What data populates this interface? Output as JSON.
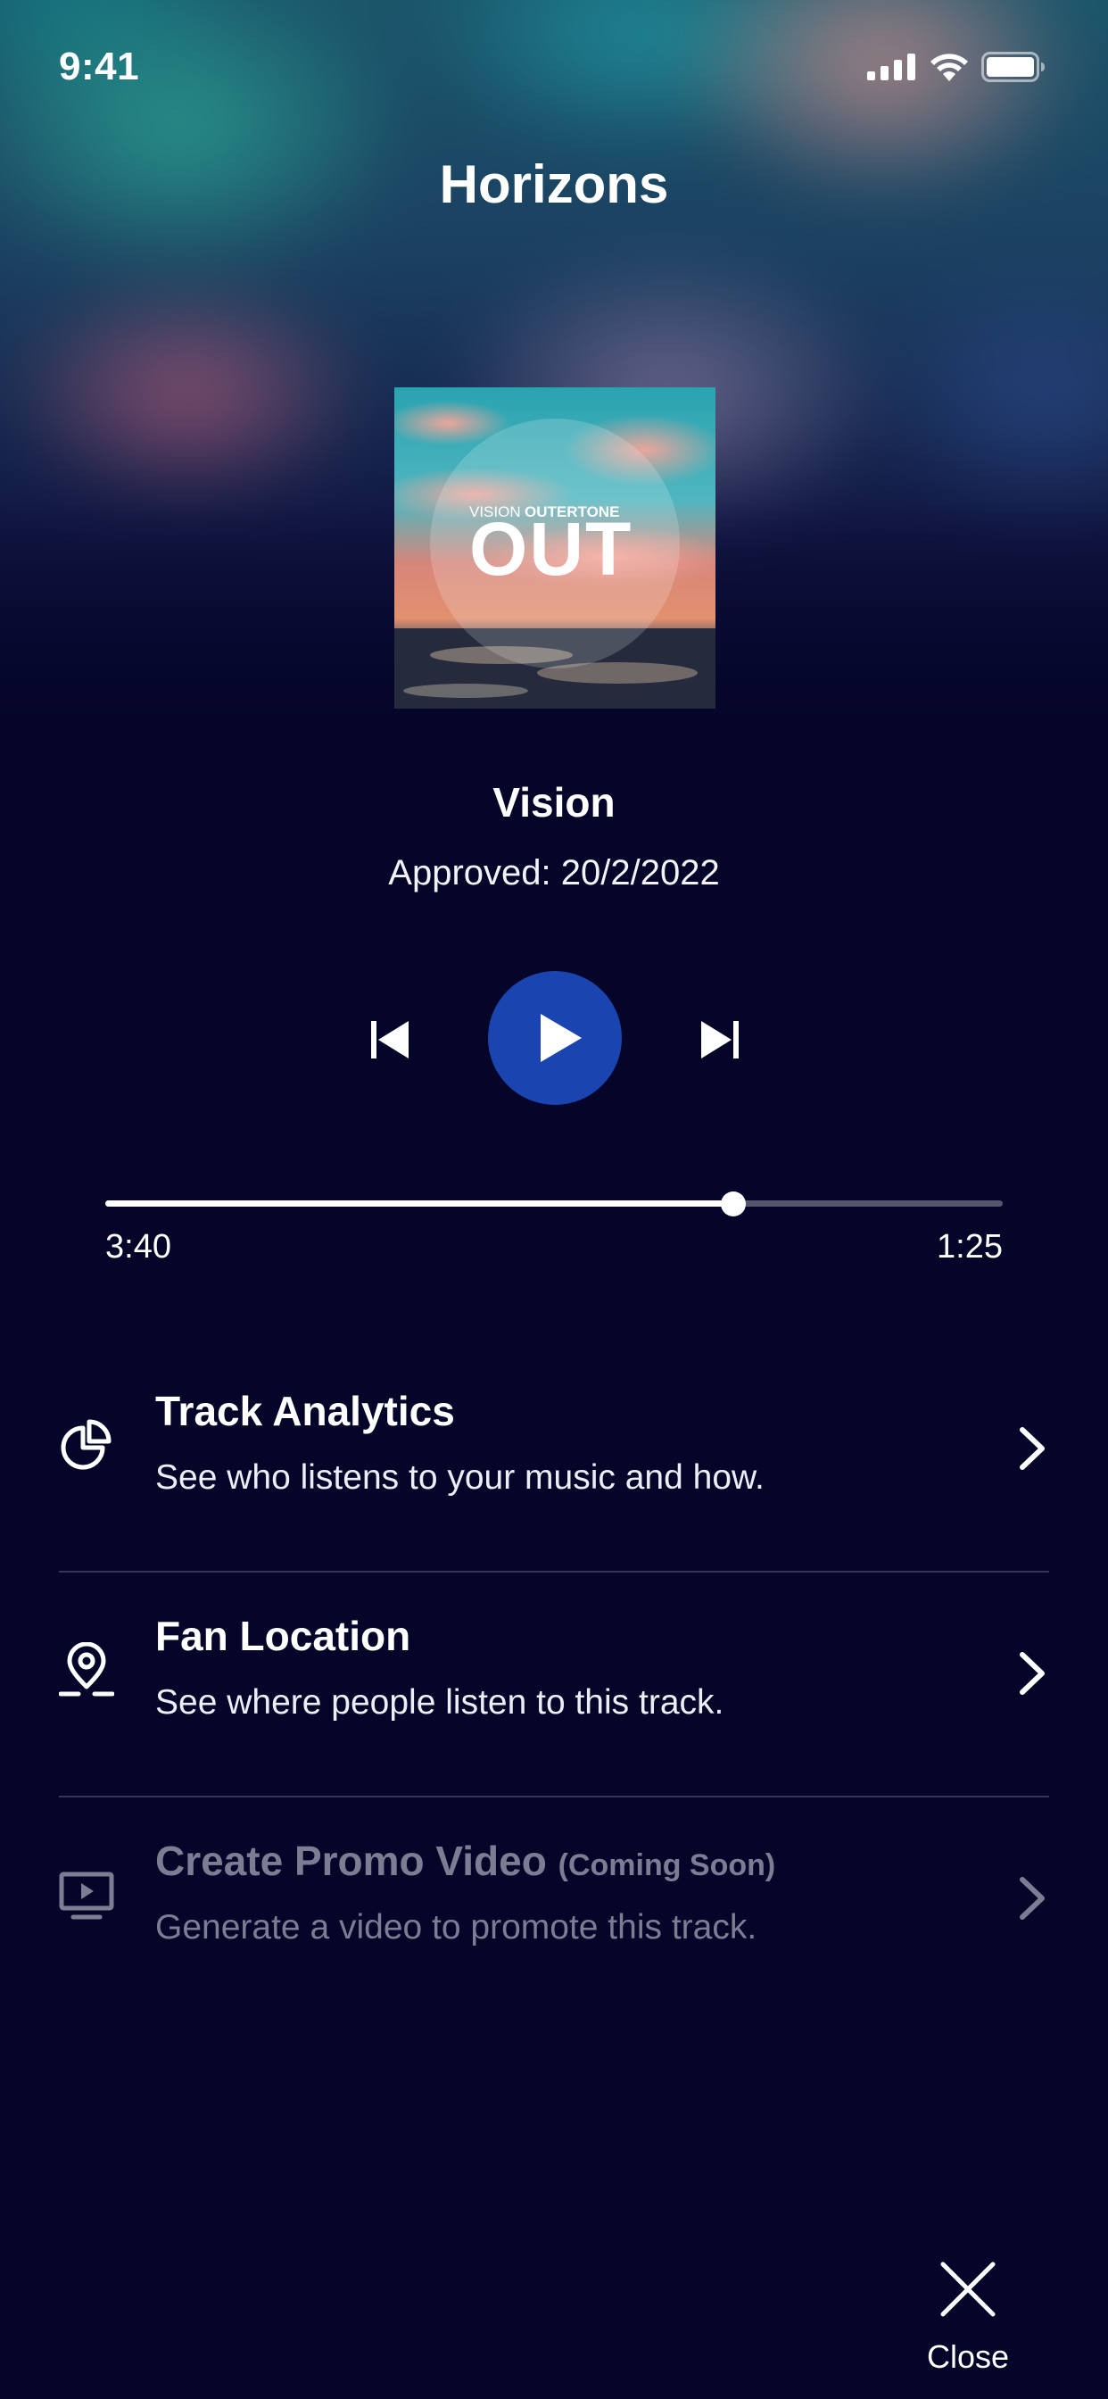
{
  "status_bar": {
    "time": "9:41",
    "icons": [
      "cellular-signal-icon",
      "wifi-icon",
      "battery-icon"
    ]
  },
  "screen": {
    "title": "Horizons"
  },
  "album_art": {
    "label_small": "VISION",
    "label_brand": "OUTERTONE",
    "label_large": "OUT"
  },
  "track": {
    "title": "Vision",
    "approved": "Approved: 20/2/2022"
  },
  "controls": {
    "prev_icon": "skip-previous-icon",
    "play_icon": "play-icon",
    "next_icon": "skip-next-icon",
    "play_color": "#1a45b0"
  },
  "progress": {
    "elapsed": "3:40",
    "remaining": "1:25",
    "fraction": 0.7
  },
  "menu": [
    {
      "icon": "pie-chart-icon",
      "title": "Track Analytics",
      "subtitle": "See who listens to your music and how.",
      "enabled": true
    },
    {
      "icon": "location-pin-icon",
      "title": "Fan Location",
      "subtitle": "See where people listen to this track.",
      "enabled": true
    },
    {
      "icon": "video-screen-icon",
      "title": "Create Promo Video",
      "note": "(Coming Soon)",
      "subtitle": "Generate a video to promote this track.",
      "enabled": false
    }
  ],
  "close": {
    "label": "Close",
    "icon": "close-icon"
  },
  "colors": {
    "background": "#05052a",
    "accent": "#1a45b0",
    "disabled_text": "#7b7d93"
  }
}
